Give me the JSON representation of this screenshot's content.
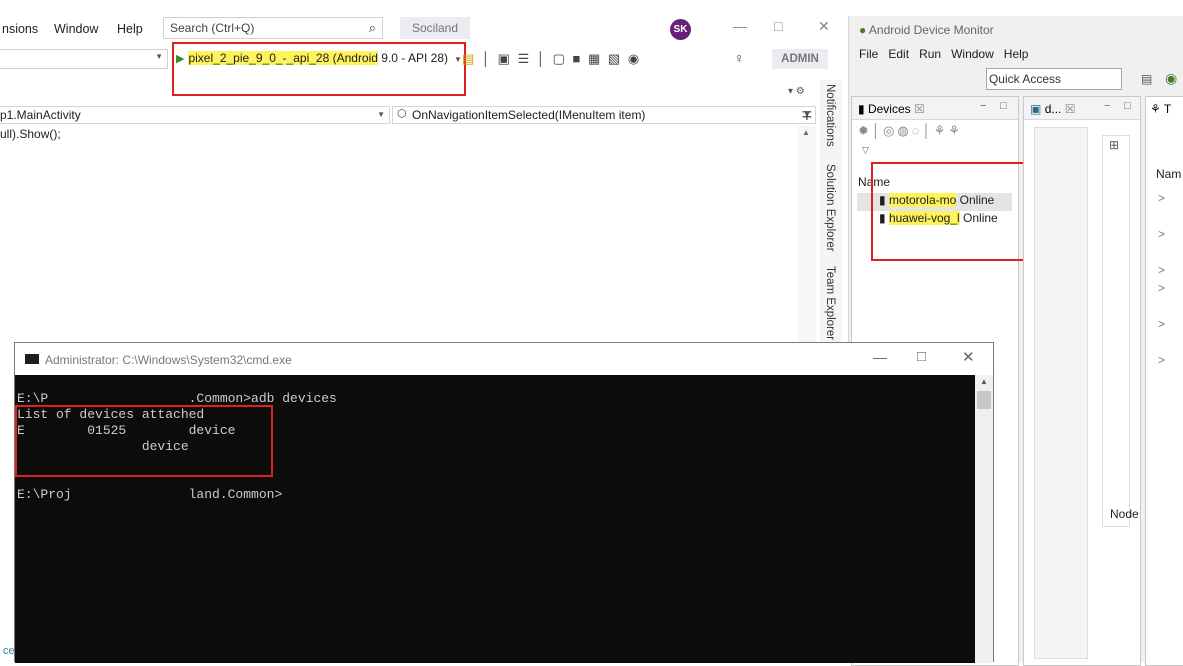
{
  "vs": {
    "menu": [
      "nsions",
      "Window",
      "Help"
    ],
    "search_placeholder": "Search (Ctrl+Q)",
    "solution_name": "Sociland",
    "avatar_initials": "SK",
    "run_target_hl": "pixel_2_pie_9_0_-_api_28 (Android",
    "run_target_rest": " 9.0 - API 28)",
    "admin_label": "ADMIN",
    "nav_left": "p1.MainActivity",
    "nav_right": "OnNavigationItemSelected(IMenuItem item)",
    "code_line": "ull).Show();",
    "side_tabs": [
      "Notifications",
      "Solution Explorer",
      "Team Explorer"
    ],
    "status_fragment": "ce"
  },
  "adm": {
    "title": "Android Device Monitor",
    "menu": [
      "File",
      "Edit",
      "Run",
      "Window",
      "Help"
    ],
    "quick_access": "Quick Access",
    "devices_tab": "Devices",
    "second_tab": "d...",
    "third_tab_fragment": "T",
    "name_header": "Name",
    "node_header": "Node",
    "name_header_right": "Nam",
    "devices": [
      {
        "hl": "motorola-mo",
        "rest": "",
        "status": "Online"
      },
      {
        "hl": "huawei-vog_l",
        "rest": "",
        "status": "Online"
      }
    ]
  },
  "cmd": {
    "title": "Administrator: C:\\Windows\\System32\\cmd.exe",
    "lines": [
      "E:\\P                  .Common>adb devices",
      "List of devices attached",
      "E        01525        device",
      "                device",
      "",
      "E:\\Proj               land.Common>"
    ]
  },
  "colors": {
    "highlight": "#fff35c",
    "annotation_red": "#e02020",
    "vs_purple": "#68217a"
  }
}
